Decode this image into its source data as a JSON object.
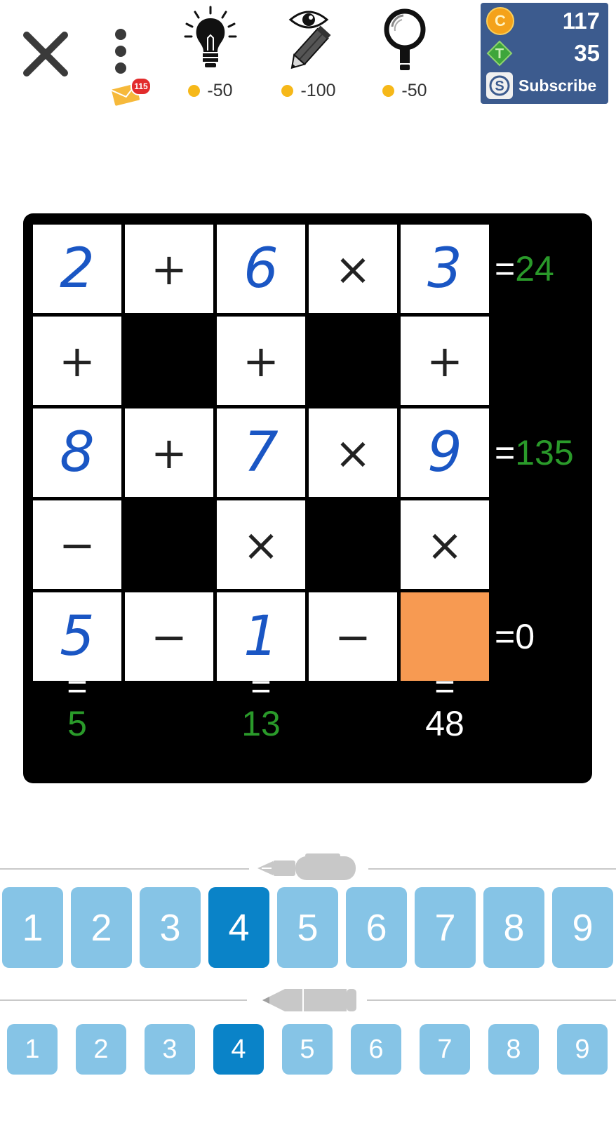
{
  "toolbar": {
    "mail_count": "115",
    "tools": [
      {
        "name": "hint",
        "icon": "lightbulb-icon",
        "cost": "-50"
      },
      {
        "name": "reveal",
        "icon": "eye-pencil-icon",
        "cost": "-100"
      },
      {
        "name": "check",
        "icon": "magnifier-icon",
        "cost": "-50"
      }
    ],
    "wallet": {
      "coins": "117",
      "coin_letter": "C",
      "tokens": "35",
      "token_letter": "T",
      "subscribe_label": "Subscribe"
    }
  },
  "board": {
    "rows": [
      [
        "2",
        "+",
        "6",
        "×",
        "3"
      ],
      [
        "+",
        "",
        "+",
        "",
        "+"
      ],
      [
        "8",
        "+",
        "7",
        "×",
        "9"
      ],
      [
        "−",
        "",
        "×",
        "",
        "×"
      ],
      [
        "5",
        "−",
        "1",
        "−",
        ""
      ]
    ],
    "row_results": [
      {
        "eq": "=",
        "value": "24",
        "solved": true
      },
      {
        "eq": "=",
        "value": "135",
        "solved": true
      },
      {
        "eq": "=",
        "value": "0",
        "solved": false
      }
    ],
    "col_results": [
      {
        "eq": "=",
        "value": "5",
        "solved": true
      },
      {
        "eq": "=",
        "value": "13",
        "solved": true
      },
      {
        "eq": "=",
        "value": "48",
        "solved": false
      }
    ],
    "selected_cell": [
      4,
      4
    ],
    "colors": {
      "number": "#1a56c4",
      "solved": "#2a9a2a",
      "selected": "#f79a52"
    }
  },
  "pen_pad": {
    "icon": "pen-icon",
    "keys": [
      "1",
      "2",
      "3",
      "4",
      "5",
      "6",
      "7",
      "8",
      "9"
    ],
    "active": "4"
  },
  "pencil_pad": {
    "icon": "pencil-icon",
    "keys": [
      "1",
      "2",
      "3",
      "4",
      "5",
      "6",
      "7",
      "8",
      "9"
    ],
    "active": "4"
  }
}
